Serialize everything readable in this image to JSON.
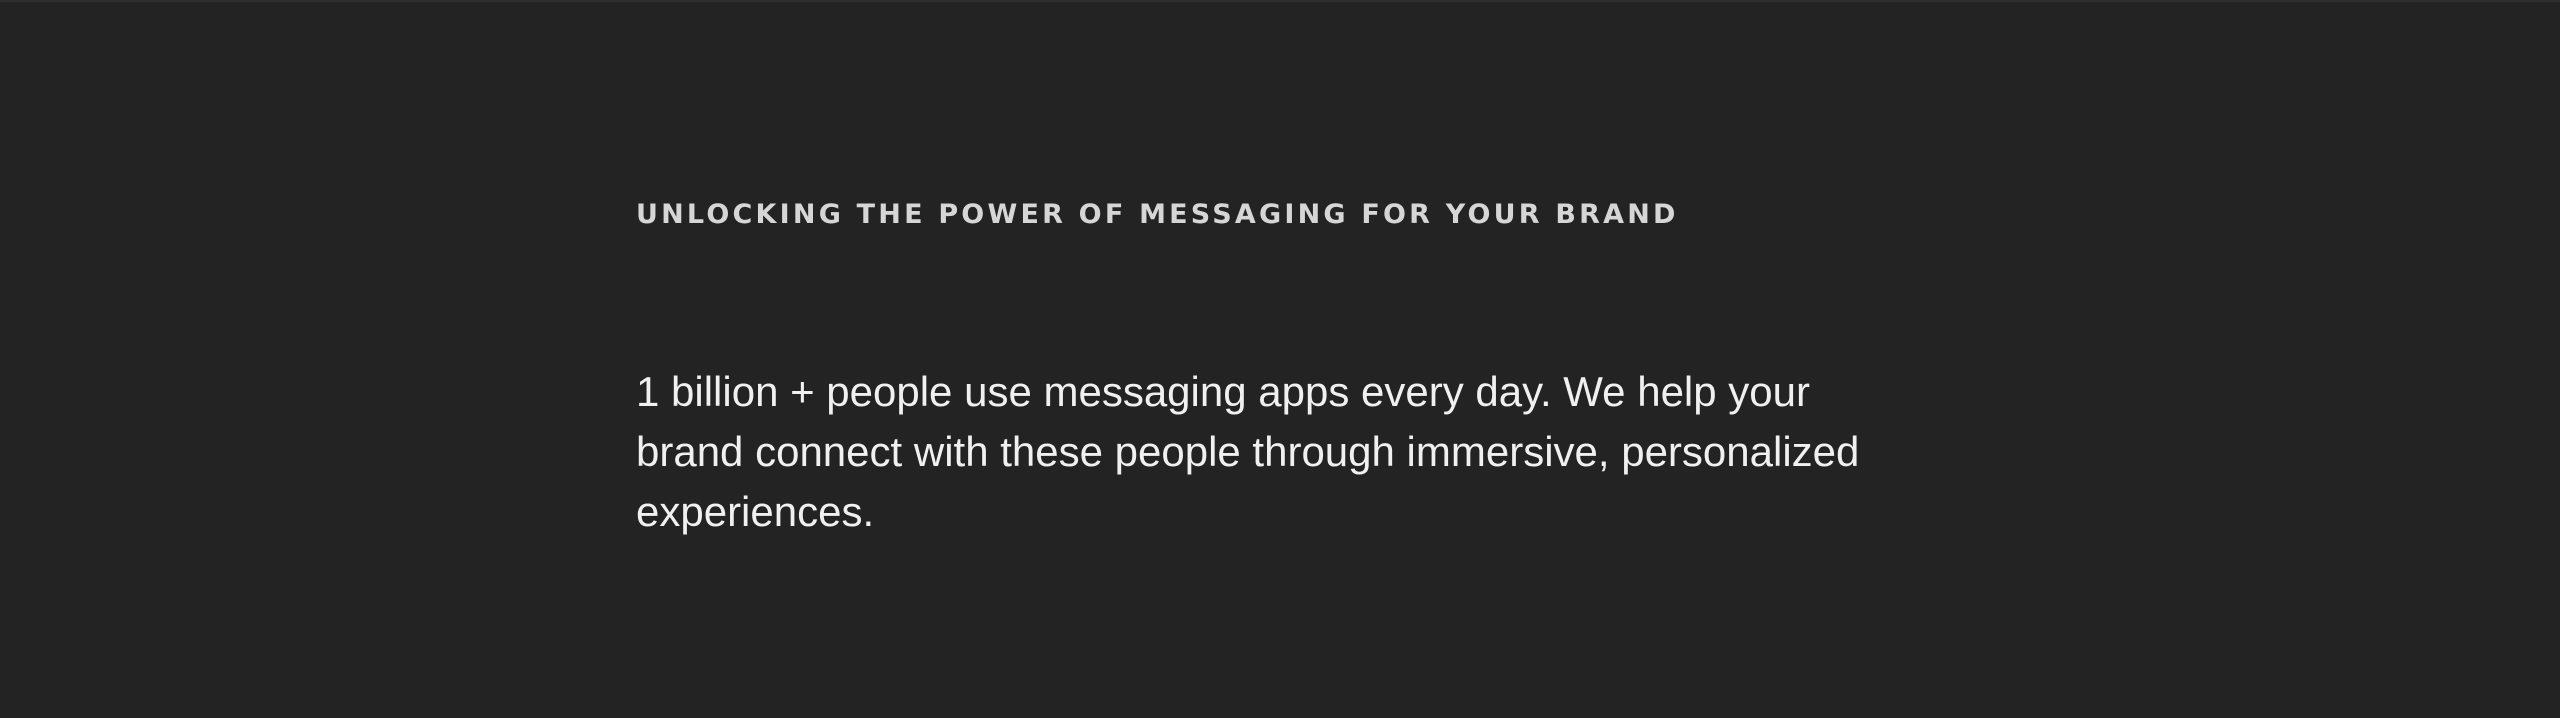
{
  "hero": {
    "eyebrow": "UNLOCKING THE POWER OF MESSAGING FOR YOUR BRAND",
    "lead": "1 billion + people use messaging apps every day. We help your brand connect with these people through immersive, personalized experiences."
  },
  "colors": {
    "background": "#232323",
    "eyebrow_text": "#d6d6d6",
    "lead_text": "#f0f0f0"
  }
}
